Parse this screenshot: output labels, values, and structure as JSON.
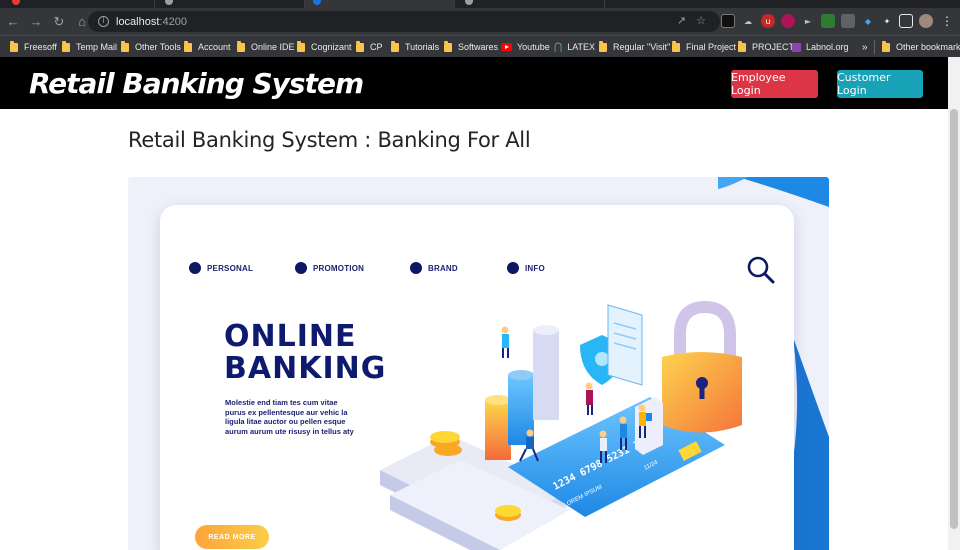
{
  "browser": {
    "url_host": "localhost",
    "url_port": ":4200",
    "bookmarks": [
      {
        "label": "Freesoff",
        "icon": "folder-icon"
      },
      {
        "label": "Temp Mail",
        "icon": "folder-icon"
      },
      {
        "label": "Other Tools",
        "icon": "folder-icon"
      },
      {
        "label": "Account",
        "icon": "folder-icon"
      },
      {
        "label": "Online IDE",
        "icon": "folder-icon"
      },
      {
        "label": "Cognizant",
        "icon": "folder-icon"
      },
      {
        "label": "CP",
        "icon": "folder-icon"
      },
      {
        "label": "Tutorials",
        "icon": "folder-icon"
      },
      {
        "label": "Softwares",
        "icon": "folder-icon"
      },
      {
        "label": "Youtube",
        "icon": "youtube-icon"
      },
      {
        "label": "LATEX",
        "icon": "latex-icon"
      },
      {
        "label": "Regular \"Visit\"",
        "icon": "folder-icon"
      },
      {
        "label": "Final Project",
        "icon": "folder-icon"
      },
      {
        "label": "PROJECT",
        "icon": "folder-icon"
      },
      {
        "label": "Labnol.org",
        "icon": "labnol-icon"
      }
    ],
    "overflow": "»",
    "other_bookmarks": "Other bookmarks"
  },
  "navbar": {
    "brand": "Retail Banking System",
    "employee_login": "Employee Login",
    "customer_login": "Customer Login",
    "employee_color": "#dc3545",
    "customer_color": "#17a2b8"
  },
  "main": {
    "title": "Retail Banking System : Banking For All"
  },
  "hero": {
    "menu": [
      "PERSONAL",
      "PROMOTION",
      "BRAND",
      "INFO"
    ],
    "title_line1": "ONLINE",
    "title_line2": "BANKING",
    "description": "Molestie end tiam tes cum vitae purus ex pellentesque aur vehic la ligula litae auctor ou pellen esque aurum aurum ute risusy in tellus aty",
    "card_number": "1234 6798 5231 1523",
    "card_expiry": "11/24",
    "card_name": "LOREM IPSUM",
    "read_more": "READ MORE"
  }
}
